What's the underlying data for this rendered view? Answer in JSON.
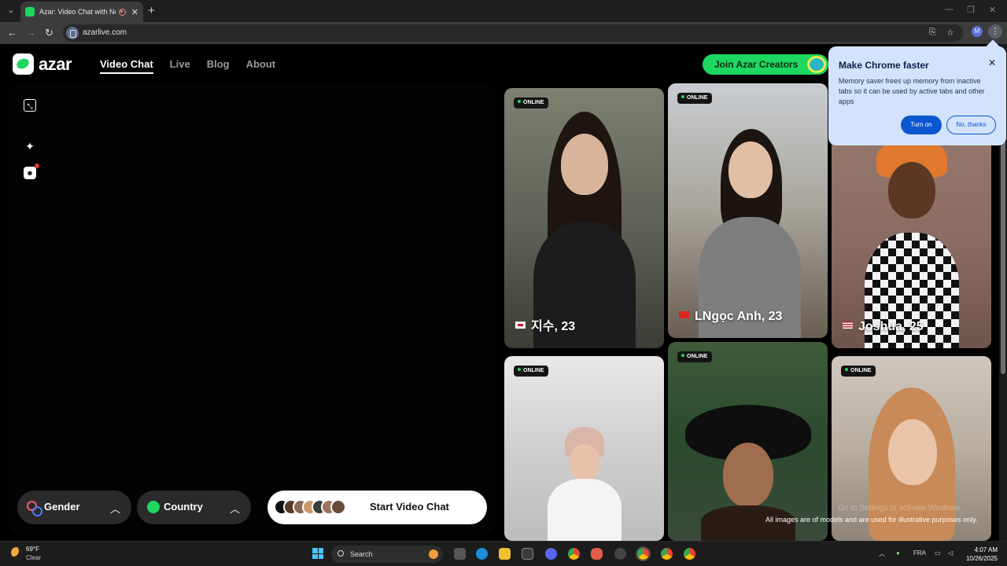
{
  "browser": {
    "tab_title": "Azar: Video Chat with New",
    "url": "azarlive.com",
    "profile_initial": "M"
  },
  "site": {
    "logo": "azar",
    "nav": [
      {
        "label": "Video Chat",
        "active": true
      },
      {
        "label": "Live",
        "active": false
      },
      {
        "label": "Blog",
        "active": false
      },
      {
        "label": "About",
        "active": false
      }
    ],
    "creators_button": "Join Azar Creators"
  },
  "controls": {
    "gender_label": "Gender",
    "country_label": "Country",
    "start_label": "Start Video Chat"
  },
  "cards": [
    {
      "status": "ONLINE",
      "name": "지수, 23",
      "flag": "KR"
    },
    {
      "status": "ONLINE",
      "name": "LNgọc Anh, 23",
      "flag": "VN"
    },
    {
      "status": "",
      "name": "Joshua, 25",
      "flag": "US"
    },
    {
      "status": "ONLINE",
      "name": "",
      "flag": ""
    },
    {
      "status": "ONLINE",
      "name": "",
      "flag": ""
    },
    {
      "status": "ONLINE",
      "name": "",
      "flag": ""
    }
  ],
  "disclaimer": "All images are of models and are used for illustrative purposes only.",
  "watermark": "Go to Settings to activate Windows.",
  "popup": {
    "title": "Make Chrome faster",
    "body": "Memory saver frees up memory from inactive tabs so it can be used by active tabs and other apps",
    "primary": "Turn on",
    "secondary": "No, thanks"
  },
  "taskbar": {
    "temperature": "69°F",
    "condition": "Clear",
    "search_label": "Search",
    "language": "FRA",
    "time": "4:07 AM",
    "date": "10/26/2025"
  },
  "colors": {
    "brand_green": "#1ed760",
    "chrome_popup": "#d3e3fd",
    "chrome_button": "#0b57d0"
  }
}
